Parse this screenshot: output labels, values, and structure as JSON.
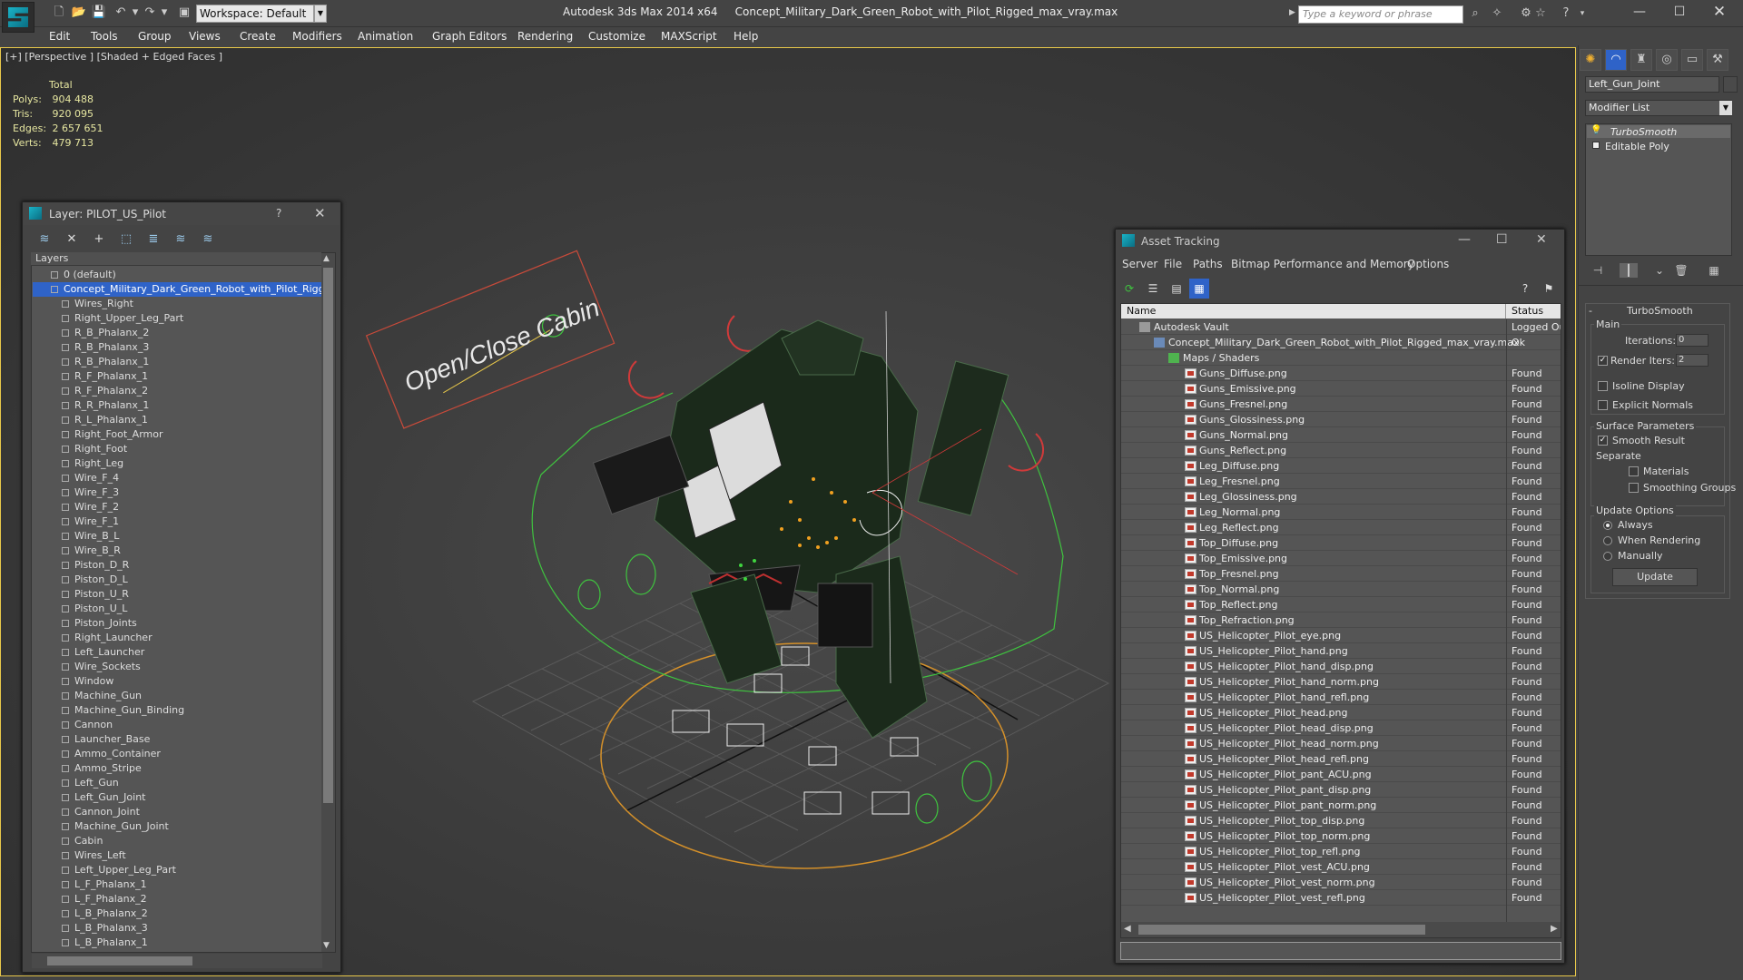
{
  "app": {
    "title": "Autodesk 3ds Max  2014 x64",
    "file": "Concept_Military_Dark_Green_Robot_with_Pilot_Rigged_max_vray.max",
    "workspace": "Workspace: Default",
    "search_placeholder": "Type a keyword or phrase"
  },
  "menu": [
    "Edit",
    "Tools",
    "Group",
    "Views",
    "Create",
    "Modifiers",
    "Animation",
    "Graph Editors",
    "Rendering",
    "Customize",
    "MAXScript",
    "Help"
  ],
  "viewport": {
    "label": "[+] [Perspective ] [Shaded + Edged Faces ]",
    "stats": {
      "header": "Total",
      "polys_label": "Polys:",
      "polys": "904 488",
      "tris_label": "Tris:",
      "tris": "920 095",
      "edges_label": "Edges:",
      "edges": "2 657 651",
      "verts_label": "Verts:",
      "verts": "479 713"
    },
    "cabin_sign": "Open/Close Cabin"
  },
  "command_panel": {
    "object_name": "Left_Gun_Joint",
    "modifier_list": "Modifier List",
    "stack": [
      "TurboSmooth",
      "Editable Poly"
    ],
    "rollout_title": "TurboSmooth",
    "main_label": "Main",
    "iterations_label": "Iterations:",
    "iterations": "0",
    "render_iters_label": "Render Iters:",
    "render_iters": "2",
    "isoline": "Isoline Display",
    "explicit_normals": "Explicit Normals",
    "surface_params": "Surface Parameters",
    "smooth_result": "Smooth Result",
    "separate": "Separate",
    "materials": "Materials",
    "smoothing_groups": "Smoothing Groups",
    "update_options": "Update Options",
    "always": "Always",
    "when_rendering": "When Rendering",
    "manually": "Manually",
    "update_button": "Update"
  },
  "layer_panel": {
    "title": "Layer: PILOT_US_Pilot",
    "help": "?",
    "header": "Layers",
    "default_layer": "0 (default)",
    "selected_layer": "Concept_Military_Dark_Green_Robot_with_Pilot_Rigged",
    "objects": [
      "Wires_Right",
      "Right_Upper_Leg_Part",
      "R_B_Phalanx_2",
      "R_B_Phalanx_3",
      "R_B_Phalanx_1",
      "R_F_Phalanx_1",
      "R_F_Phalanx_2",
      "R_R_Phalanx_1",
      "R_L_Phalanx_1",
      "Right_Foot_Armor",
      "Right_Foot",
      "Right_Leg",
      "Wire_F_4",
      "Wire_F_3",
      "Wire_F_2",
      "Wire_F_1",
      "Wire_B_L",
      "Wire_B_R",
      "Piston_D_R",
      "Piston_D_L",
      "Piston_U_R",
      "Piston_U_L",
      "Piston_Joints",
      "Right_Launcher",
      "Left_Launcher",
      "Wire_Sockets",
      "Window",
      "Machine_Gun",
      "Machine_Gun_Binding",
      "Cannon",
      "Launcher_Base",
      "Ammo_Container",
      "Ammo_Stripe",
      "Left_Gun",
      "Left_Gun_Joint",
      "Cannon_Joint",
      "Machine_Gun_Joint",
      "Cabin",
      "Wires_Left",
      "Left_Upper_Leg_Part",
      "L_F_Phalanx_1",
      "L_F_Phalanx_2",
      "L_B_Phalanx_2",
      "L_B_Phalanx_3",
      "L_B_Phalanx_1"
    ]
  },
  "asset_panel": {
    "title": "Asset Tracking",
    "menu": [
      "Server",
      "File",
      "Paths",
      "Bitmap Performance and Memory",
      "Options"
    ],
    "col_name": "Name",
    "col_status": "Status",
    "vault": "Autodesk Vault",
    "vault_status": "Logged Out",
    "maxfile": "Concept_Military_Dark_Green_Robot_with_Pilot_Rigged_max_vray.max",
    "maxfile_status": "Ok",
    "maps_folder": "Maps / Shaders",
    "found_label": "Found",
    "maps": [
      "Guns_Diffuse.png",
      "Guns_Emissive.png",
      "Guns_Fresnel.png",
      "Guns_Glossiness.png",
      "Guns_Normal.png",
      "Guns_Reflect.png",
      "Leg_Diffuse.png",
      "Leg_Fresnel.png",
      "Leg_Glossiness.png",
      "Leg_Normal.png",
      "Leg_Reflect.png",
      "Top_Diffuse.png",
      "Top_Emissive.png",
      "Top_Fresnel.png",
      "Top_Normal.png",
      "Top_Reflect.png",
      "Top_Refraction.png",
      "US_Helicopter_Pilot_eye.png",
      "US_Helicopter_Pilot_hand.png",
      "US_Helicopter_Pilot_hand_disp.png",
      "US_Helicopter_Pilot_hand_norm.png",
      "US_Helicopter_Pilot_hand_refl.png",
      "US_Helicopter_Pilot_head.png",
      "US_Helicopter_Pilot_head_disp.png",
      "US_Helicopter_Pilot_head_norm.png",
      "US_Helicopter_Pilot_head_refl.png",
      "US_Helicopter_Pilot_pant_ACU.png",
      "US_Helicopter_Pilot_pant_disp.png",
      "US_Helicopter_Pilot_pant_norm.png",
      "US_Helicopter_Pilot_top_disp.png",
      "US_Helicopter_Pilot_top_norm.png",
      "US_Helicopter_Pilot_top_refl.png",
      "US_Helicopter_Pilot_vest_ACU.png",
      "US_Helicopter_Pilot_vest_norm.png",
      "US_Helicopter_Pilot_vest_refl.png"
    ]
  }
}
